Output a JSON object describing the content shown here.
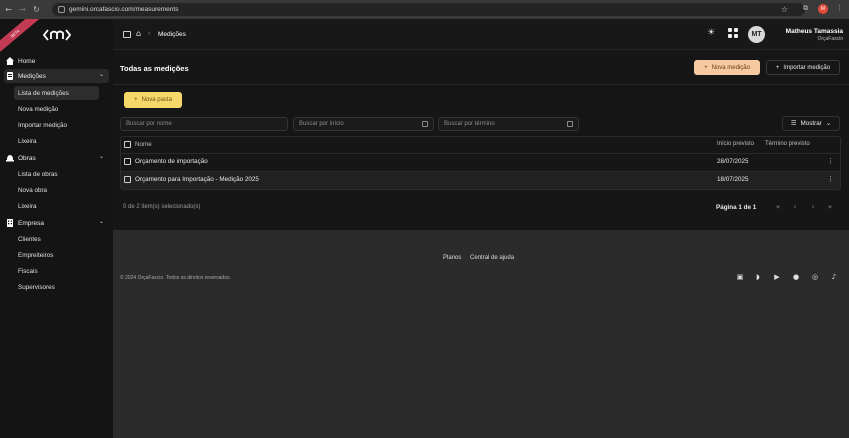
{
  "browser": {
    "url": "gemini.orcafascio.com/measurements"
  },
  "sidebar": {
    "ribbon": "BETA",
    "sections": [
      {
        "label": "Home"
      },
      {
        "label": "Medições",
        "items": [
          "Lista de medições",
          "Nova medição",
          "Importar medição",
          "Lixeira"
        ]
      },
      {
        "label": "Obras",
        "items": [
          "Lista de obras",
          "Nova obra",
          "Lixeira"
        ]
      },
      {
        "label": "Empresa",
        "items": [
          "Clientes",
          "Empreiteiros",
          "Fiscais",
          "Supervisores"
        ]
      }
    ]
  },
  "header": {
    "breadcrumb": "Medições",
    "user": {
      "initials": "MT",
      "name": "Matheus Tamassia",
      "org": "OrçaFascio"
    }
  },
  "main": {
    "title": "Todas as medições",
    "new_button": "Nova medição",
    "import_button": "Importar medição",
    "new_folder_button": "Nova pasta",
    "filters": {
      "name_placeholder": "Buscar por nome",
      "start_placeholder": "Buscar por início",
      "end_placeholder": "Buscar por término"
    },
    "show_button": "Mostrar",
    "table": {
      "headers": {
        "name": "Nome",
        "start": "Início previsto",
        "end": "Término previsto"
      },
      "rows": [
        {
          "name": "Orçamento de importação",
          "start": "28/07/2025",
          "end": ""
        },
        {
          "name": "Orçamento para Importação - Medição 2025",
          "start": "18/07/2025",
          "end": ""
        }
      ]
    },
    "selection": "0 de 2 item(s) selecionado(s)",
    "page": "Página 1 de 1"
  },
  "footer": {
    "links": [
      "Planos",
      "Central de ajuda"
    ],
    "copyright": "© 2024 OrçaFascio. Todos os direitos reservados."
  },
  "colors": {
    "accent_primary": "#f6c9a0",
    "accent_folder": "#f5d76a",
    "ribbon": "#c23b52"
  }
}
